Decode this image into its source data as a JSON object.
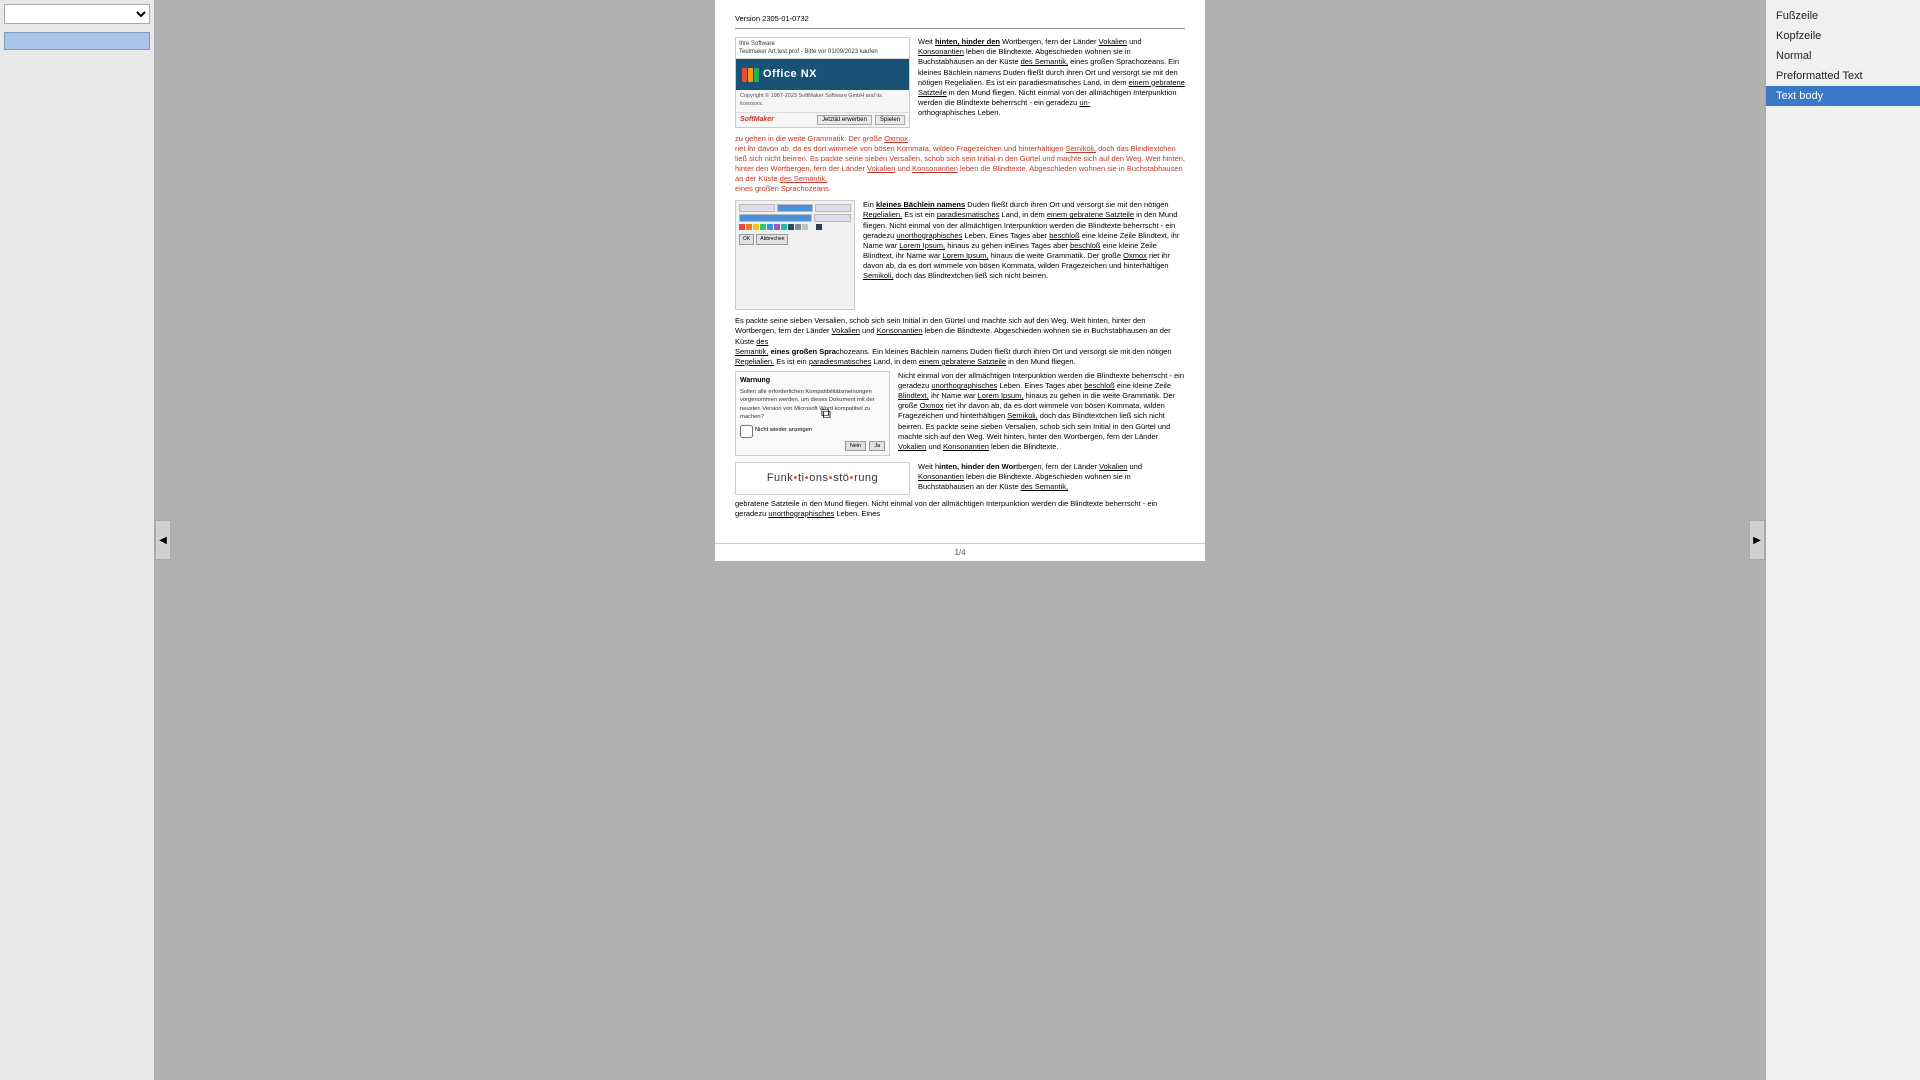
{
  "left_sidebar": {
    "select_value": "",
    "select_placeholder": ""
  },
  "document": {
    "version": "Version 2305-01-0732",
    "page_number": "1/4",
    "paragraphs": {
      "intro_text": "Weit hinten, hinter den Wortbergen, fern der Länder Vokalien und Konsonantien leben die Blindtexte. Abgeschieden wohnen sie in Buchstabhausen an der Küste des Semantik, eines großen Sprachozeans. Ein kleines Bächlein namens Duden fließt durch ihren Ort und versorgt sie mit den nötigen Regelialien. Es ist ein paradiesmatisches Land, in dem einem gebratene Satzteile in den Mund fliegen. Nicht einmal von der allmächtigen Interpunktion werden die Blindtexte beherrscht - ein geradezu unorthographisches Leben.",
      "red_para": "zu gehen in die weite Grammatik. Der große Oxmox riet ihr davon ab, da es dort wimmele von bösen Kommata, wilden Fragezeichen und hinterhältigen Semikoli, doch das Blindtextchen ließ sich nicht beirren. Es packte seine sieben Versalien, schob sich sein Initial in den Gürtel und machte sich auf den Weg. Weit hinten, hinter den Wortbergen, fern der Länder Vokalien und Konsonantien leben die Blindtexte. Abgeschieden wohnen sie in Buchstabhausen an der Küste des Semantik, eines großen Sprachozeans.",
      "second_block": "Ein kleines Bächlein namens Duden fließt durch ihren Ort und versorgt sie mit den nötigen Regelialien. Es ist ein paradiesmatisches Land, in dem einem gebratene Satzteile in den Mund fliegen. Nicht einmal von der allmächtigen Interpunktion werden die Blindtexte beherrscht - ein geradezu unorthographisches Leben. Eines Tages aber beschloß eine kleine Zeile Blindtext, ihr Name war Lorem Ipsum, hinaus zu gehen inEines Tages aber beschloß eine kleine Zeile Blindtext, ihr Name war Lorem Ipsum, hinaus die weite Grammatik. Der große Oxmox riet ihr davon ab, da es dort wimmele von bösen Kommata, wilden Fragezeichen und hinterhältigen Semikoli, doch das Blindtextchen ließ sich nicht beirren.",
      "third_para": "Es packte seine sieben Versalien, schob sich sein Initial in den Gürtel und machte sich auf den Weg. Weit hinten, hinter den Wortbergen, fern der Länder Vokalien und Konsonantien leben die Blindtexte. Abgeschieden wohnen sie in Buchstabhausen an der Küste des Semantik, eines großen Sprachozeans. Ein kleines Bächlein namens Duden fließt durch ihren Ort und versorgt sie mit den nötigen Regelialien. Es ist ein paradiesmatisches Land, in dem einem gebratene Satzteile in den Mund fliegen.",
      "fourth_para": "Nicht einmal von der allmächtigen Interpunktion werden die Blindtexte beherrscht - ein geradezu unorthographisches Leben. Eines Tages aber beschloß eine kleine Zeile Blindtext, ihr Name war Lorem Ipsum, hinaus zu gehen in die weite Grammatik. Der große Oxmox riet ihr davon ab, da es dort wimmele von bösen Kommata, wilden Fragezeichen und hinterhältigen Semikoli, doch das Blindtextchen ließ sich nicht beirren. Es packte seine sieben Versalien, schob sich sein Initial in den Gürtel und machte sich auf den Weg. Weit hinten, hinter den Wortbergen, fern der Länder Vokalien und Konsonantien leben die Blindtexte.",
      "fifth_para": "Weit hinten, hinter den Wortbergen, fern der Länder Vokalien und Konsonantien leben die Blindtexte. Abgeschieden wohnen sie in Buchstabhausen an der Küste,",
      "sixth_para": "gebratene Satzteile in den Mund fliegen. Nicht einmal von der allmächtigen Interpunktion werden die Blindtexte beherrscht - ein geradezu unorthographisches Leben. Eines"
    },
    "image1": {
      "top_text": "Ihre Software",
      "subtitle": "Testmaker Art.test.prof - Bitte vor 01/09/2023 kaufen",
      "brand": "Office NX",
      "sub_brand": "SoftMaker",
      "copyright": "Copyright © 1987-2023 SoftMaker Software GmbH and its licensors.",
      "footer_logo": "SoftMaker",
      "btn1": "Jetzt&t erwerben",
      "btn2": "Spielen"
    },
    "image2_caption": "",
    "warning": {
      "title": "Warnung",
      "text": "Sollen alle erforderlichen Kompatibilitätsmeinungen vorgenommen werden, um dieses Dokument mit der neusten Version von Microsoft Word kompatibel zu machen?",
      "checkbox": "Nicht wieder anzeigen",
      "btn_cancel": "Nein",
      "btn_ok": "Ja"
    },
    "funk_text": "Funk•ti•ons•stö•rung"
  },
  "right_sidebar": {
    "items": [
      {
        "label": "Fußzeile",
        "active": false
      },
      {
        "label": "Kopfzeile",
        "active": false
      },
      {
        "label": "Normal",
        "active": false
      },
      {
        "label": "Preformatted Text",
        "active": false
      },
      {
        "label": "Text body",
        "active": true
      }
    ]
  }
}
